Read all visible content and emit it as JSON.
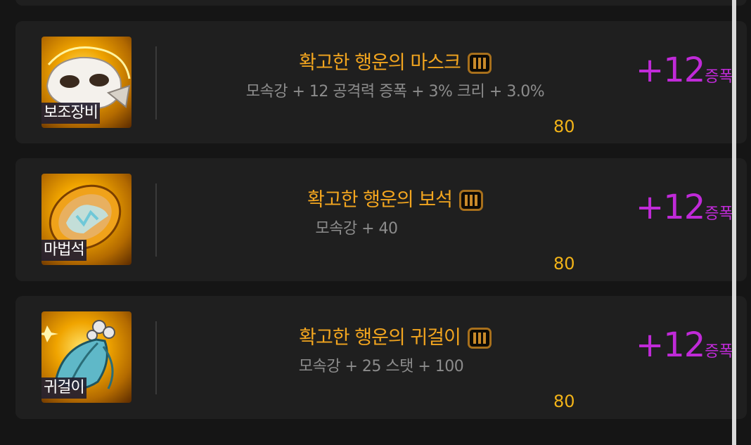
{
  "items": [
    {
      "slot": "보조장비",
      "name": "확고한 행운의 마스크",
      "stats": "모속강 + 12 공격력 증폭 + 3% 크리 + 3.0%",
      "level": "80",
      "bonus_value": "+12",
      "bonus_label": "증폭",
      "icon": "mask-icon"
    },
    {
      "slot": "마법석",
      "name": "확고한 행운의 보석",
      "stats": "모속강 + 40",
      "level": "80",
      "bonus_value": "+12",
      "bonus_label": "증폭",
      "icon": "gem-icon"
    },
    {
      "slot": "귀걸이",
      "name": "확고한 행운의 귀걸이",
      "stats": "모속강 + 25 스탯 + 100",
      "level": "80",
      "bonus_value": "+12",
      "bonus_label": "증폭",
      "icon": "earring-icon"
    }
  ],
  "tier_badge": "III",
  "colors": {
    "name": "#f2a51f",
    "stats": "#8c8c8c",
    "level": "#f2b318",
    "bonus": "#c02ad8",
    "card_bg": "#1f1f1f",
    "page_bg": "#151515"
  }
}
